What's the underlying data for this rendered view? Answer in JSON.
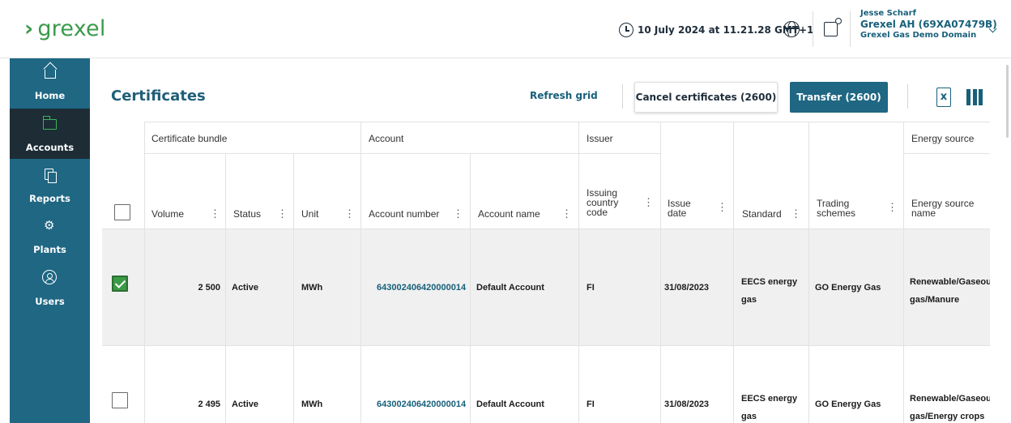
{
  "header": {
    "logo_chevron": "›",
    "logo_text": "grexel",
    "datetime": "10 July 2024 at 11.21.28 GMT+1",
    "user_name": "Jesse Scharf",
    "user_company": "Grexel AH (69XA07479B)",
    "user_domain": "Grexel Gas Demo Domain"
  },
  "sidebar": {
    "items": [
      {
        "label": "Home",
        "icon": "home-icon"
      },
      {
        "label": "Accounts",
        "icon": "folder-icon",
        "active": true
      },
      {
        "label": "Reports",
        "icon": "reports-icon"
      },
      {
        "label": "Plants",
        "icon": "plants-icon"
      },
      {
        "label": "Users",
        "icon": "users-icon"
      }
    ]
  },
  "toolbar": {
    "title": "Certificates",
    "refresh_label": "Refresh grid",
    "cancel_label": "Cancel certificates (2600)",
    "transfer_label": "Transfer (2600)"
  },
  "table": {
    "groups": {
      "bundle": "Certificate bundle",
      "account": "Account",
      "issuer": "Issuer",
      "energy": "Energy source"
    },
    "columns": {
      "volume": "Volume",
      "status": "Status",
      "unit": "Unit",
      "account_number": "Account number",
      "account_name": "Account name",
      "country_l1": "Issuing",
      "country_l2": "country",
      "country_l3": "code",
      "issue_l1": "Issue",
      "issue_l2": "date",
      "standard": "Standard",
      "trading_l1": "Trading",
      "trading_l2": "schemes",
      "energy_l1": "Energy source",
      "energy_l2": "name"
    },
    "rows": [
      {
        "checked": true,
        "volume": "2 500",
        "status": "Active",
        "unit": "MWh",
        "account_number": "643002406420000014",
        "account_name": "Default Account",
        "country": "FI",
        "issue_date": "31/08/2023",
        "standard_l1": "EECS energy",
        "standard_l2": "gas",
        "trading": "GO Energy Gas",
        "energy_l1": "Renewable/Gaseou",
        "energy_l2": "gas/Manure"
      },
      {
        "checked": false,
        "volume": "2 495",
        "status": "Active",
        "unit": "MWh",
        "account_number": "643002406420000014",
        "account_name": "Default Account",
        "country": "FI",
        "issue_date": "31/08/2023",
        "standard_l1": "EECS energy",
        "standard_l2": "gas",
        "trading": "GO Energy Gas",
        "energy_l1": "Renewable/Gaseou",
        "energy_l2": "gas/Energy crops"
      }
    ]
  },
  "colors": {
    "brand_green": "#3b9a4b",
    "sidebar_bg": "#1f6783",
    "sidebar_active": "#1d2c35",
    "accent_teal": "#17607a"
  }
}
